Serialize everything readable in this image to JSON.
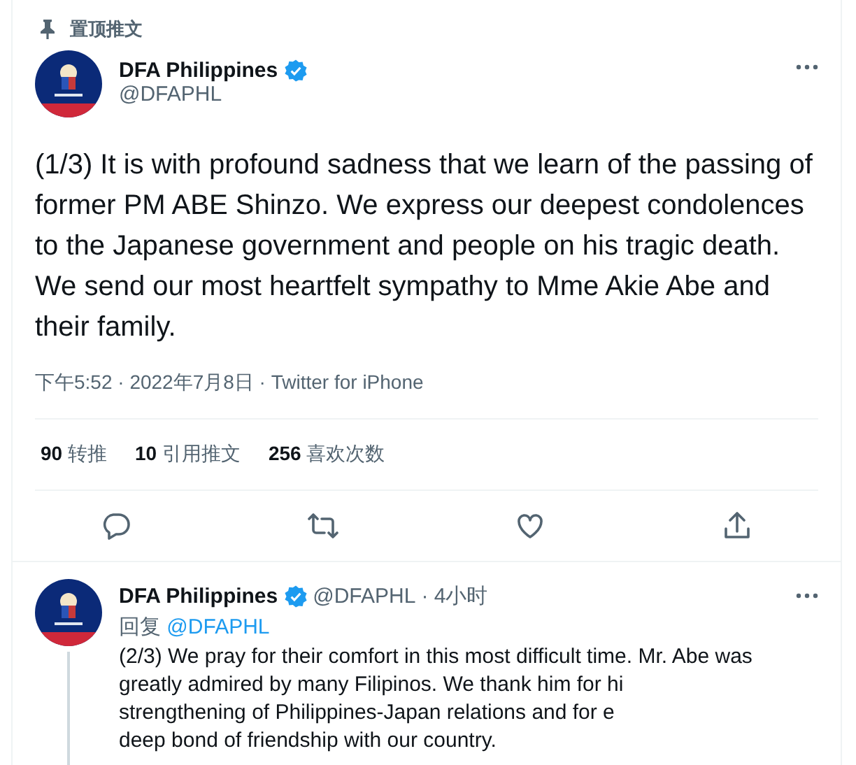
{
  "pinned_label": "置顶推文",
  "tweet": {
    "author": "DFA Philippines",
    "verified": true,
    "handle": "@DFAPHL",
    "text": "(1/3) It is with profound sadness that we learn of the passing of former PM ABE Shinzo.  We express our deepest condolences to the Japanese government and people on his tragic death. We send our most heartfelt sympathy to Mme Akie Abe and their family.",
    "meta": "下午5:52 · 2022年7月8日 · Twitter for iPhone",
    "stats": [
      {
        "count": "90",
        "label": "转推"
      },
      {
        "count": "10",
        "label": "引用推文"
      },
      {
        "count": "256",
        "label": "喜欢次数"
      }
    ]
  },
  "reply": {
    "author": "DFA Philippines",
    "verified": true,
    "handle": "@DFAPHL",
    "time": "· 4小时",
    "reply_prefix": "回复",
    "reply_to": "@DFAPHL",
    "lines": [
      "(2/3) We pray for their comfort in this most difficult time. Mr. Abe was",
      "greatly admired by many Filipinos. We thank him for hi",
      "strengthening of Philippines-Japan relations and for e",
      "deep bond of friendship with our country."
    ]
  }
}
